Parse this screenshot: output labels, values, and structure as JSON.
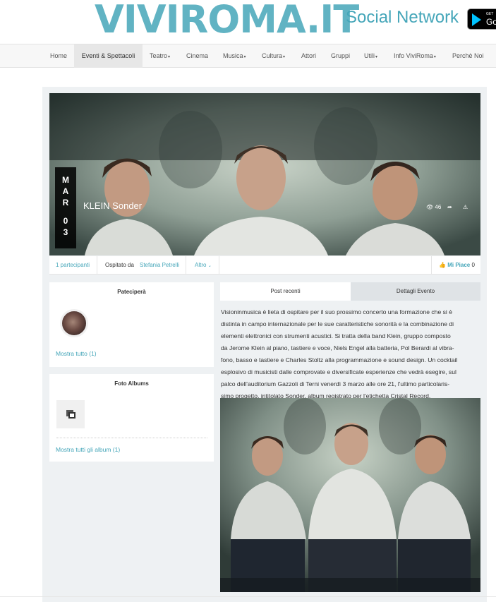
{
  "header": {
    "logo_text": "VIVIROMA.IT",
    "tagline": "Social Network",
    "store_badge_top": "GET",
    "store_badge_name": "Go",
    "brand_color": "#45a6b9"
  },
  "nav": {
    "items": [
      {
        "label": "Home"
      },
      {
        "label": "Eventi & Spettacoli",
        "active": true
      },
      {
        "label": "Teatro"
      },
      {
        "label": "Cinema"
      },
      {
        "label": "Musica"
      },
      {
        "label": "Cultura"
      },
      {
        "label": "Attori"
      },
      {
        "label": "Gruppi"
      },
      {
        "label": "Utili"
      },
      {
        "label": "Info ViviRoma"
      },
      {
        "label": "Perchè Noi"
      }
    ]
  },
  "event": {
    "month": [
      "M",
      "A",
      "R"
    ],
    "day": [
      "0",
      "3"
    ],
    "title": "KLEIN Sonder",
    "views": "46",
    "icons": [
      "eye-icon",
      "share-icon",
      "warning-icon"
    ]
  },
  "infobar": {
    "participants": "1 partecipanti",
    "hosted_label": "Ospitato da",
    "host_name": "Stefania Petrelli",
    "more_label": "Altro",
    "like_label": "Mi Piace",
    "like_count": "0"
  },
  "attend_box": {
    "title": "Pateciperà",
    "show_all": "Mostra tutto (1)"
  },
  "albums_box": {
    "title": "Foto Albums",
    "show_all": "Mostra tutti gli album (1)"
  },
  "tabs": {
    "recent_posts": "Post recenti",
    "event_details": "Dettagli Evento"
  },
  "description": {
    "lines": [
      "Visioninmusica è lieta di ospitare per il suo prossimo concerto una formazione che si è",
      "distinta in campo internazionale per le sue caratteristiche sonorità e la combinazione di",
      "elementi elettronici con strumenti acustici. Si tratta della band Klein, gruppo composto",
      "da Jerome Klein al piano, tastiere e voce, Niels Engel alla batteria, Pol Berardi al vibra-",
      "fono, basso e tastiere e Charles Stoltz alla programmazione e sound design. Un cocktail",
      "esplosivo di musicisti dalle comprovate e diversificate esperienze che vedrà esegire, sul",
      "palco dell'auditorium Gazzoli di Terni venerdì 3 marzo alle ore 21, l'ultimo particolaris-",
      "simo progetto, intitolato Sonder, album registrato per l'etichetta Cristal Record."
    ]
  }
}
